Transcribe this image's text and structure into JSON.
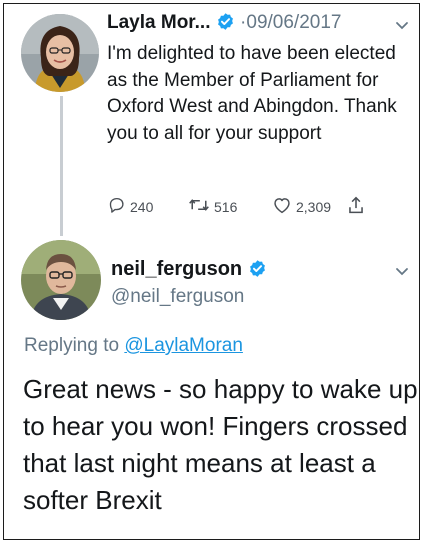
{
  "colors": {
    "accent": "#1da1f2",
    "verified": "#1da1f2",
    "muted": "#657786",
    "thread_line": "#c8cdd2"
  },
  "tweet1": {
    "author_name": "Layla Mor...",
    "separator": "·",
    "date": "09/06/2017",
    "text": "I'm delighted to have been elected as the Member of Parliament for Oxford West and Abingdon. Thank you to all for your support",
    "replies": "240",
    "retweets": "516",
    "likes": "2,309",
    "icons": {
      "reply": "reply-icon",
      "retweet": "retweet-icon",
      "like": "heart-icon",
      "share": "share-icon",
      "verified": "verified-badge-icon",
      "menu": "chevron-down-icon"
    }
  },
  "tweet2": {
    "author_name": "neil_ferguson",
    "handle": "@neil_ferguson",
    "replying_prefix": "Replying to ",
    "replying_to": "@LaylaMoran",
    "text": "Great news - so happy to wake up to hear you won! Fingers crossed that last night means at least a softer Brexit",
    "icons": {
      "verified": "verified-badge-icon",
      "menu": "chevron-down-icon"
    }
  }
}
